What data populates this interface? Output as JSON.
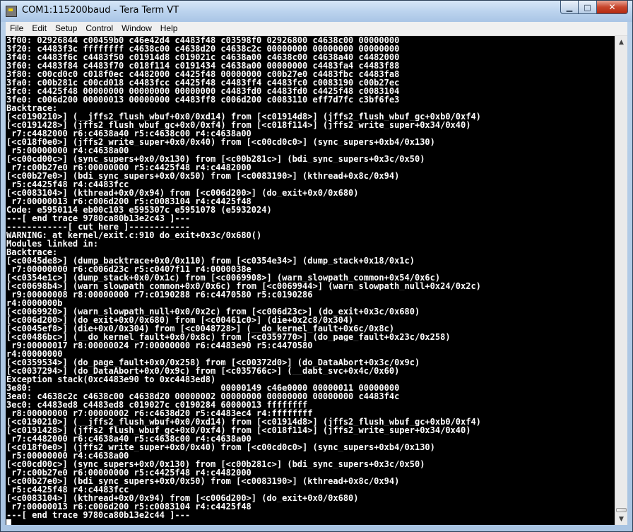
{
  "window": {
    "title": "COM1:115200baud - Tera Term VT",
    "controls": {
      "minimize": "▁",
      "maximize": "□",
      "close": "✕"
    }
  },
  "menu": {
    "items": [
      "File",
      "Edit",
      "Setup",
      "Control",
      "Window",
      "Help"
    ]
  },
  "terminal": {
    "lines": [
      "3f00: 02926844 c00459b0 c46e42d4 c4483f48 c03598f0 02926800 c4638c00 00000000",
      "3f20: c4483f3c ffffffff c4638c00 c4638d20 c4638c2c 00000000 00000000 00000000",
      "3f40: c4483f6c c4483f50 c01914d8 c019021c c4638a00 c4638c00 c4638a40 c4482000",
      "3f60: c4483f84 c4483f70 c018f114 c0191434 c4638a00 00000000 c4483fa4 c4483f88",
      "3f80: c00cd0c0 c018f0ec c4482000 c4425f48 00000000 c00b27e0 c4483fbc c4483fa8",
      "3fa0: c00b281c c00cd018 c4483fcc c4425f48 c4483ff4 c4483fc0 c0083190 c00b27ec",
      "3fc0: c4425f48 00000000 00000000 00000000 c4483fd0 c4483fd0 c4425f48 c0083104",
      "3fe0: c006d200 00000013 00000000 c4483ff8 c006d200 c0083110 eff7d7fc c3bf6fe3",
      "Backtrace:",
      "[<c0190210>] (__jffs2_flush_wbuf+0x0/0xd14) from [<c01914d8>] (jffs2_flush_wbuf_gc+0xb0/0xf4)",
      "[<c0191428>] (jffs2_flush_wbuf_gc+0x0/0xf4) from [<c018f114>] (jffs2_write_super+0x34/0x40)",
      " r7:c4482000 r6:c4638a40 r5:c4638c00 r4:c4638a00",
      "[<c018f0e0>] (jffs2_write_super+0x0/0x40) from [<c00cd0c0>] (sync_supers+0xb4/0x130)",
      " r5:00000000 r4:c4638a00",
      "[<c00cd00c>] (sync_supers+0x0/0x130) from [<c00b281c>] (bdi_sync_supers+0x3c/0x50)",
      " r7:c00b27e0 r6:00000000 r5:c4425f48 r4:c4482000",
      "[<c00b27e0>] (bdi_sync_supers+0x0/0x50) from [<c0083190>] (kthread+0x8c/0x94)",
      " r5:c4425f48 r4:c4483fcc",
      "[<c0083104>] (kthread+0x0/0x94) from [<c006d200>] (do_exit+0x0/0x680)",
      " r7:00000013 r6:c006d200 r5:c0083104 r4:c4425f48",
      "Code: e5950114 eb00c103 e595307c e5951078 (e5932024)",
      "---[ end trace 9780ca80b13e2c43 ]---",
      "------------[ cut here ]------------",
      "WARNING: at kernel/exit.c:910 do_exit+0x3c/0x680()",
      "Modules linked in:",
      "Backtrace:",
      "[<c0045de8>] (dump_backtrace+0x0/0x110) from [<c0354e34>] (dump_stack+0x18/0x1c)",
      " r7:00000000 r6:c006d23c r5:c0407f11 r4:0000038e",
      "[<c0354e1c>] (dump_stack+0x0/0x1c) from [<c0069908>] (warn_slowpath_common+0x54/0x6c)",
      "[<c00698b4>] (warn_slowpath_common+0x0/0x6c) from [<c0069944>] (warn_slowpath_null+0x24/0x2c)",
      " r9:00000008 r8:00000000 r7:c0190288 r6:c4470580 r5:c0190286",
      "r4:0000000b",
      "[<c0069920>] (warn_slowpath_null+0x0/0x2c) from [<c006d23c>] (do_exit+0x3c/0x680)",
      "[<c006d200>] (do_exit+0x0/0x680) from [<c00461c0>] (die+0x2c8/0x304)",
      "[<c0045ef8>] (die+0x0/0x304) from [<c0048728>] (__do_kernel_fault+0x6c/0x8c)",
      "[<c00486bc>] (__do_kernel_fault+0x0/0x8c) from [<c0359770>] (do_page_fault+0x23c/0x258)",
      " r9:00000017 r8:00000024 r7:00000000 r6:c4483e90 r5:c4470580",
      "r4:00000000",
      "[<c0359534>] (do_page_fault+0x0/0x258) from [<c00372d0>] (do_DataAbort+0x3c/0x9c)",
      "[<c0037294>] (do_DataAbort+0x0/0x9c) from [<c035766c>] (__dabt_svc+0x4c/0x60)",
      "Exception stack(0xc4483e90 to 0xc4483ed8)",
      "3e80:                                     00000149 c46e0000 00000011 00000000",
      "3ea0: c4638c2c c4638c00 c4638d20 00000002 00000000 00000000 00000000 c4483f4c",
      "3ec0: c4483ed8 c4483ed8 c019027c c0190284 60000013 ffffffff",
      " r8:00000000 r7:00000002 r6:c4638d20 r5:c4483ec4 r4:ffffffff",
      "[<c0190210>] (__jffs2_flush_wbuf+0x0/0xd14) from [<c01914d8>] (jffs2_flush_wbuf_gc+0xb0/0xf4)",
      "[<c0191428>] (jffs2_flush_wbuf_gc+0x0/0xf4) from [<c018f114>] (jffs2_write_super+0x34/0x40)",
      " r7:c4482000 r6:c4638a40 r5:c4638c00 r4:c4638a00",
      "[<c018f0e0>] (jffs2_write_super+0x0/0x40) from [<c00cd0c0>] (sync_supers+0xb4/0x130)",
      " r5:00000000 r4:c4638a00",
      "[<c00cd00c>] (sync_supers+0x0/0x130) from [<c00b281c>] (bdi_sync_supers+0x3c/0x50)",
      " r7:c00b27e0 r6:00000000 r5:c4425f48 r4:c4482000",
      "[<c00b27e0>] (bdi_sync_supers+0x0/0x50) from [<c0083190>] (kthread+0x8c/0x94)",
      " r5:c4425f48 r4:c4483fcc",
      "[<c0083104>] (kthread+0x0/0x94) from [<c006d200>] (do_exit+0x0/0x680)",
      " r7:00000013 r6:c006d200 r5:c0083104 r4:c4425f48",
      "---[ end trace 9780ca80b13e2c44 ]---"
    ]
  },
  "scrollbar": {
    "up_icon": "▲",
    "down_icon": "▼"
  },
  "colors": {
    "terminal_bg": "#000000",
    "terminal_fg": "#ffffff",
    "title_bg": "#bcd4ee",
    "close_btn": "#c7452c"
  }
}
